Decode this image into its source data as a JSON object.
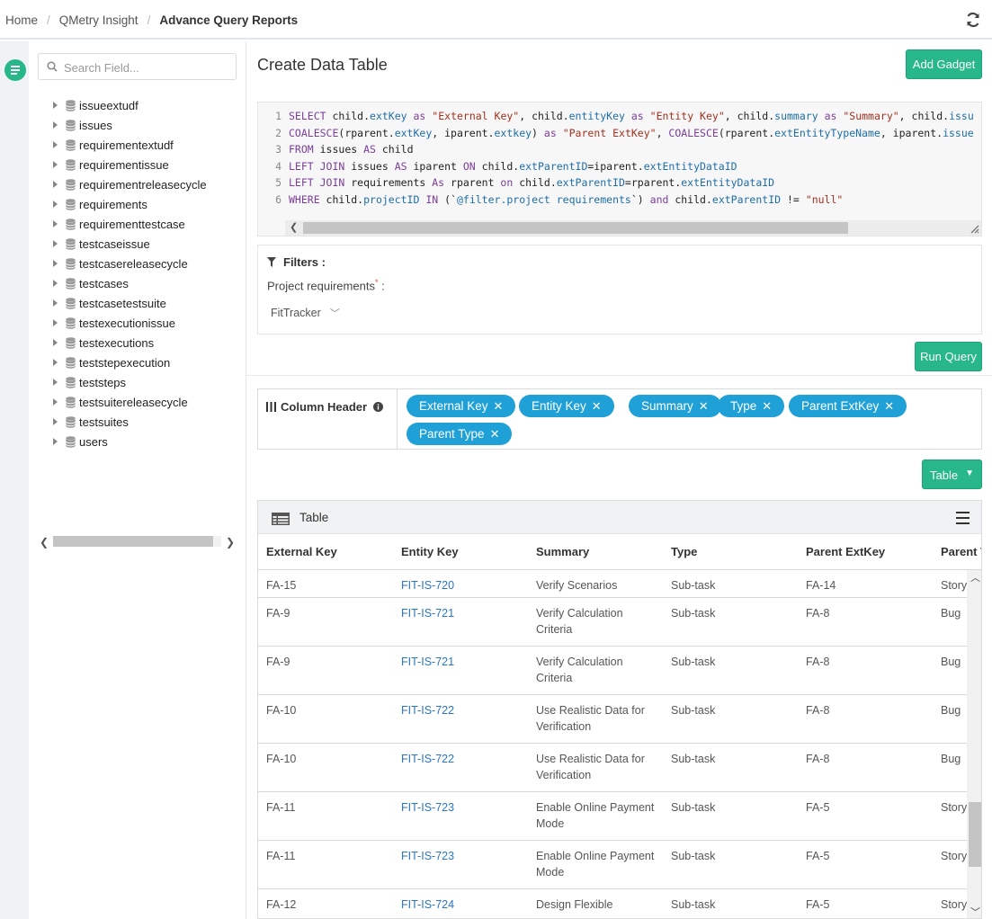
{
  "breadcrumb": [
    "Home",
    "QMetry Insight",
    "Advance Query Reports"
  ],
  "sidebar": {
    "search_placeholder": "Search Field...",
    "fields": [
      "issueextudf",
      "issues",
      "requirementextudf",
      "requirementissue",
      "requirementreleasecycle",
      "requirements",
      "requirementtestcase",
      "testcaseissue",
      "testcasereleasecycle",
      "testcases",
      "testcasetestsuite",
      "testexecutionissue",
      "testexecutions",
      "teststepexecution",
      "teststeps",
      "testsuitereleasecycle",
      "testsuites",
      "users"
    ]
  },
  "main": {
    "title": "Create Data Table",
    "add_gadget": "Add Gadget",
    "run_query": "Run Query",
    "table_button": "Table"
  },
  "query": {
    "line_numbers": [
      "1",
      "2",
      "3",
      "4",
      "5",
      "6"
    ]
  },
  "filters": {
    "title": "Filters :",
    "label": "Project requirements",
    "required_mark": "*",
    "colon": ":",
    "selected": "FitTracker"
  },
  "column_header": {
    "label": "Column Header",
    "chips": [
      "External Key",
      "Entity Key",
      "Summary",
      "Type",
      "Parent ExtKey",
      "Parent Type"
    ]
  },
  "table": {
    "panel_title": "Table",
    "columns": [
      "External Key",
      "Entity Key",
      "Summary",
      "Type",
      "Parent ExtKey",
      "Parent Type"
    ],
    "rows": [
      {
        "ext": "FA-15",
        "entity": "FIT-IS-720",
        "summary": [
          "Verify Scenarios"
        ],
        "type": "Sub-task",
        "parent": "FA-14",
        "ptype": "Story"
      },
      {
        "ext": "FA-9",
        "entity": "FIT-IS-721",
        "summary": [
          "Verify Calculation",
          "Criteria"
        ],
        "type": "Sub-task",
        "parent": "FA-8",
        "ptype": "Bug"
      },
      {
        "ext": "FA-9",
        "entity": "FIT-IS-721",
        "summary": [
          "Verify Calculation",
          "Criteria"
        ],
        "type": "Sub-task",
        "parent": "FA-8",
        "ptype": "Bug"
      },
      {
        "ext": "FA-10",
        "entity": "FIT-IS-722",
        "summary": [
          "Use Realistic Data for",
          "Verification"
        ],
        "type": "Sub-task",
        "parent": "FA-8",
        "ptype": "Bug"
      },
      {
        "ext": "FA-10",
        "entity": "FIT-IS-722",
        "summary": [
          "Use Realistic Data for",
          "Verification"
        ],
        "type": "Sub-task",
        "parent": "FA-8",
        "ptype": "Bug"
      },
      {
        "ext": "FA-11",
        "entity": "FIT-IS-723",
        "summary": [
          "Enable Online Payment",
          "Mode"
        ],
        "type": "Sub-task",
        "parent": "FA-5",
        "ptype": "Story"
      },
      {
        "ext": "FA-11",
        "entity": "FIT-IS-723",
        "summary": [
          "Enable Online Payment",
          "Mode"
        ],
        "type": "Sub-task",
        "parent": "FA-5",
        "ptype": "Story"
      },
      {
        "ext": "FA-12",
        "entity": "FIT-IS-724",
        "summary": [
          "Design Flexible"
        ],
        "type": "Sub-task",
        "parent": "FA-5",
        "ptype": "Story"
      }
    ]
  },
  "colors": {
    "accent": "#27b788",
    "chip": "#1fa0d6",
    "link": "#2a76c6"
  }
}
